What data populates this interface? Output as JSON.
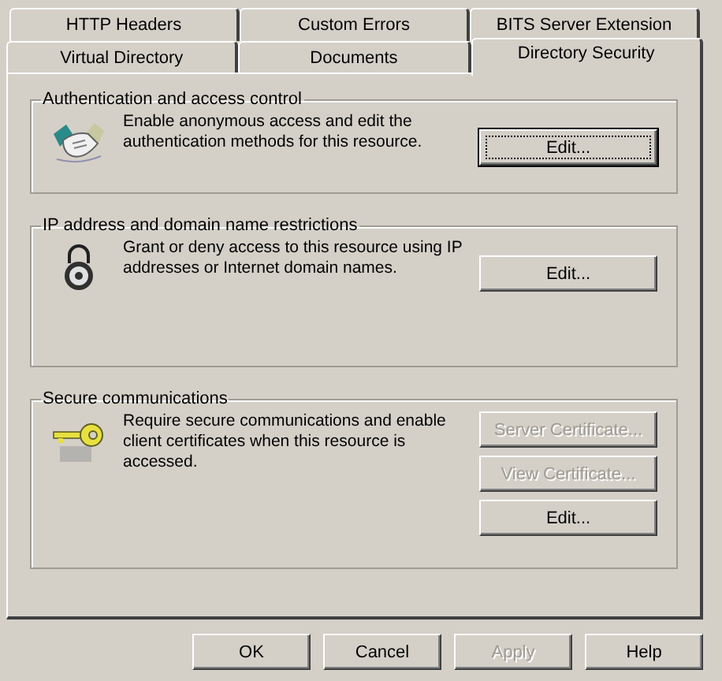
{
  "tab_rows": [
    [
      {
        "label": "HTTP Headers",
        "selected": false
      },
      {
        "label": "Custom Errors",
        "selected": false
      },
      {
        "label": "BITS Server Extension",
        "selected": false
      }
    ],
    [
      {
        "label": "Virtual Directory",
        "selected": false
      },
      {
        "label": "Documents",
        "selected": false
      },
      {
        "label": "Directory Security",
        "selected": true
      }
    ]
  ],
  "sections": [
    {
      "title": "Authentication and access control",
      "kind": "handshake",
      "description": "Enable anonymous access and edit the authentication methods for this resource.",
      "buttons": [
        {
          "label": "Edit...",
          "disabled": false,
          "focused": true
        }
      ]
    },
    {
      "title": "IP address and domain name restrictions",
      "kind": "lock",
      "description": "Grant or deny access to this resource using IP addresses or Internet domain names.",
      "buttons": [
        {
          "label": "Edit...",
          "disabled": false,
          "focused": false
        }
      ]
    },
    {
      "title": "Secure communications",
      "kind": "key",
      "description": "Require secure communications and enable client certificates when this resource is accessed.",
      "buttons": [
        {
          "label": "Server Certificate...",
          "disabled": true,
          "focused": false
        },
        {
          "label": "View Certificate...",
          "disabled": true,
          "focused": false
        },
        {
          "label": "Edit...",
          "disabled": false,
          "focused": false
        }
      ]
    }
  ],
  "footer_buttons": [
    {
      "label": "OK",
      "disabled": false
    },
    {
      "label": "Cancel",
      "disabled": false
    },
    {
      "label": "Apply",
      "disabled": true
    },
    {
      "label": "Help",
      "disabled": false
    }
  ]
}
